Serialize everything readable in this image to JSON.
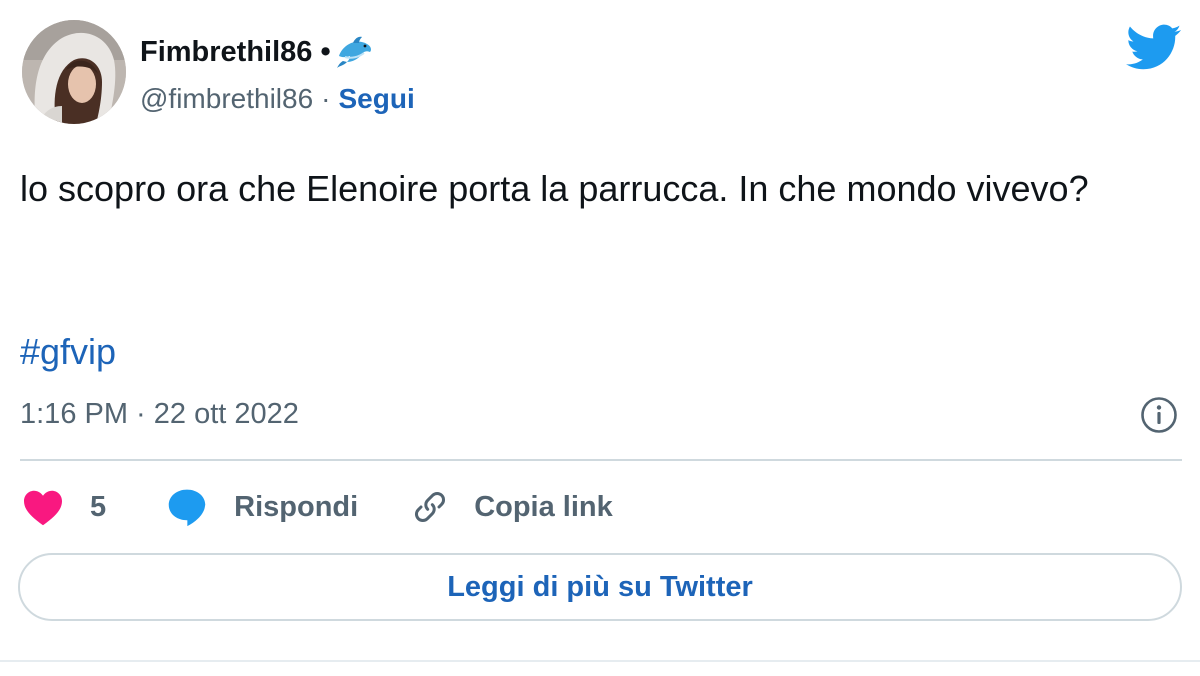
{
  "author": {
    "display_name": "Fimbrethil86",
    "name_separator": "•",
    "name_emoji": "dolphin-icon",
    "handle": "@fimbrethil86",
    "handle_separator": "·",
    "follow_label": "Segui"
  },
  "tweet": {
    "text": "lo scopro ora che Elenoire porta la parrucca. In che mondo vivevo?",
    "hashtag": "#gfvip",
    "timestamp": "1:16 PM · 22 ott 2022"
  },
  "actions": {
    "like_count": "5",
    "reply_label": "Rispondi",
    "copy_link_label": "Copia link"
  },
  "footer": {
    "read_more_label": "Leggi di più su Twitter"
  },
  "colors": {
    "link_blue": "#1d64b8",
    "twitter_blue": "#1d9bf0",
    "like_pink": "#f91880",
    "secondary_text": "#536471",
    "divider": "#cfd9de"
  }
}
